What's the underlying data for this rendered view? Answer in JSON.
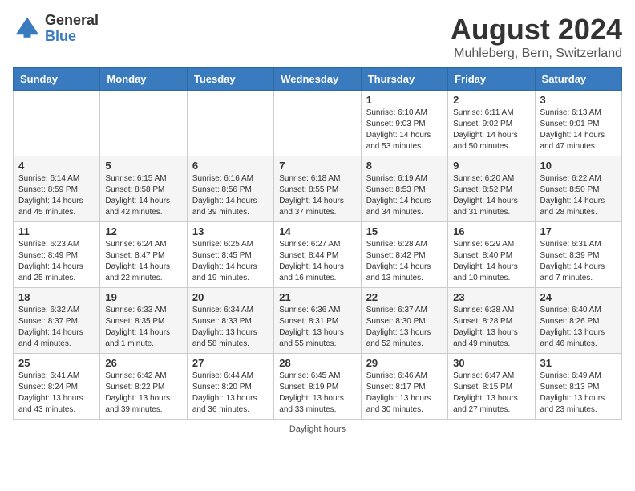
{
  "logo": {
    "general": "General",
    "blue": "Blue"
  },
  "title": "August 2024",
  "location": "Muhleberg, Bern, Switzerland",
  "days_of_week": [
    "Sunday",
    "Monday",
    "Tuesday",
    "Wednesday",
    "Thursday",
    "Friday",
    "Saturday"
  ],
  "footer": {
    "label": "Daylight hours"
  },
  "weeks": [
    [
      {
        "day": "",
        "info": ""
      },
      {
        "day": "",
        "info": ""
      },
      {
        "day": "",
        "info": ""
      },
      {
        "day": "",
        "info": ""
      },
      {
        "day": "1",
        "info": "Sunrise: 6:10 AM\nSunset: 9:03 PM\nDaylight: 14 hours\nand 53 minutes."
      },
      {
        "day": "2",
        "info": "Sunrise: 6:11 AM\nSunset: 9:02 PM\nDaylight: 14 hours\nand 50 minutes."
      },
      {
        "day": "3",
        "info": "Sunrise: 6:13 AM\nSunset: 9:01 PM\nDaylight: 14 hours\nand 47 minutes."
      }
    ],
    [
      {
        "day": "4",
        "info": "Sunrise: 6:14 AM\nSunset: 8:59 PM\nDaylight: 14 hours\nand 45 minutes."
      },
      {
        "day": "5",
        "info": "Sunrise: 6:15 AM\nSunset: 8:58 PM\nDaylight: 14 hours\nand 42 minutes."
      },
      {
        "day": "6",
        "info": "Sunrise: 6:16 AM\nSunset: 8:56 PM\nDaylight: 14 hours\nand 39 minutes."
      },
      {
        "day": "7",
        "info": "Sunrise: 6:18 AM\nSunset: 8:55 PM\nDaylight: 14 hours\nand 37 minutes."
      },
      {
        "day": "8",
        "info": "Sunrise: 6:19 AM\nSunset: 8:53 PM\nDaylight: 14 hours\nand 34 minutes."
      },
      {
        "day": "9",
        "info": "Sunrise: 6:20 AM\nSunset: 8:52 PM\nDaylight: 14 hours\nand 31 minutes."
      },
      {
        "day": "10",
        "info": "Sunrise: 6:22 AM\nSunset: 8:50 PM\nDaylight: 14 hours\nand 28 minutes."
      }
    ],
    [
      {
        "day": "11",
        "info": "Sunrise: 6:23 AM\nSunset: 8:49 PM\nDaylight: 14 hours\nand 25 minutes."
      },
      {
        "day": "12",
        "info": "Sunrise: 6:24 AM\nSunset: 8:47 PM\nDaylight: 14 hours\nand 22 minutes."
      },
      {
        "day": "13",
        "info": "Sunrise: 6:25 AM\nSunset: 8:45 PM\nDaylight: 14 hours\nand 19 minutes."
      },
      {
        "day": "14",
        "info": "Sunrise: 6:27 AM\nSunset: 8:44 PM\nDaylight: 14 hours\nand 16 minutes."
      },
      {
        "day": "15",
        "info": "Sunrise: 6:28 AM\nSunset: 8:42 PM\nDaylight: 14 hours\nand 13 minutes."
      },
      {
        "day": "16",
        "info": "Sunrise: 6:29 AM\nSunset: 8:40 PM\nDaylight: 14 hours\nand 10 minutes."
      },
      {
        "day": "17",
        "info": "Sunrise: 6:31 AM\nSunset: 8:39 PM\nDaylight: 14 hours\nand 7 minutes."
      }
    ],
    [
      {
        "day": "18",
        "info": "Sunrise: 6:32 AM\nSunset: 8:37 PM\nDaylight: 14 hours\nand 4 minutes."
      },
      {
        "day": "19",
        "info": "Sunrise: 6:33 AM\nSunset: 8:35 PM\nDaylight: 14 hours\nand 1 minute."
      },
      {
        "day": "20",
        "info": "Sunrise: 6:34 AM\nSunset: 8:33 PM\nDaylight: 13 hours\nand 58 minutes."
      },
      {
        "day": "21",
        "info": "Sunrise: 6:36 AM\nSunset: 8:31 PM\nDaylight: 13 hours\nand 55 minutes."
      },
      {
        "day": "22",
        "info": "Sunrise: 6:37 AM\nSunset: 8:30 PM\nDaylight: 13 hours\nand 52 minutes."
      },
      {
        "day": "23",
        "info": "Sunrise: 6:38 AM\nSunset: 8:28 PM\nDaylight: 13 hours\nand 49 minutes."
      },
      {
        "day": "24",
        "info": "Sunrise: 6:40 AM\nSunset: 8:26 PM\nDaylight: 13 hours\nand 46 minutes."
      }
    ],
    [
      {
        "day": "25",
        "info": "Sunrise: 6:41 AM\nSunset: 8:24 PM\nDaylight: 13 hours\nand 43 minutes."
      },
      {
        "day": "26",
        "info": "Sunrise: 6:42 AM\nSunset: 8:22 PM\nDaylight: 13 hours\nand 39 minutes."
      },
      {
        "day": "27",
        "info": "Sunrise: 6:44 AM\nSunset: 8:20 PM\nDaylight: 13 hours\nand 36 minutes."
      },
      {
        "day": "28",
        "info": "Sunrise: 6:45 AM\nSunset: 8:19 PM\nDaylight: 13 hours\nand 33 minutes."
      },
      {
        "day": "29",
        "info": "Sunrise: 6:46 AM\nSunset: 8:17 PM\nDaylight: 13 hours\nand 30 minutes."
      },
      {
        "day": "30",
        "info": "Sunrise: 6:47 AM\nSunset: 8:15 PM\nDaylight: 13 hours\nand 27 minutes."
      },
      {
        "day": "31",
        "info": "Sunrise: 6:49 AM\nSunset: 8:13 PM\nDaylight: 13 hours\nand 23 minutes."
      }
    ]
  ]
}
